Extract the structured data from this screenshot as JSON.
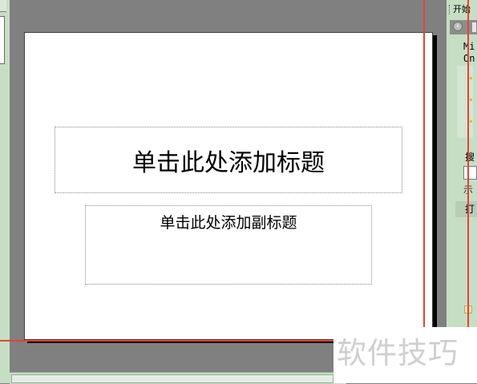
{
  "slide": {
    "title_placeholder": "单击此处添加标题",
    "subtitle_placeholder": "单击此处添加副标题"
  },
  "task_pane": {
    "header": "开始",
    "nav_back_icon": "back-arrow-icon",
    "lines": [
      "Mi",
      "On"
    ],
    "search_label": "搜",
    "example_label": "示",
    "open_section": "打"
  },
  "watermark": "软件技巧",
  "colors": {
    "workspace": "#808080",
    "pane_bg": "#c6dfc4",
    "guide_red": "#e8403a"
  }
}
